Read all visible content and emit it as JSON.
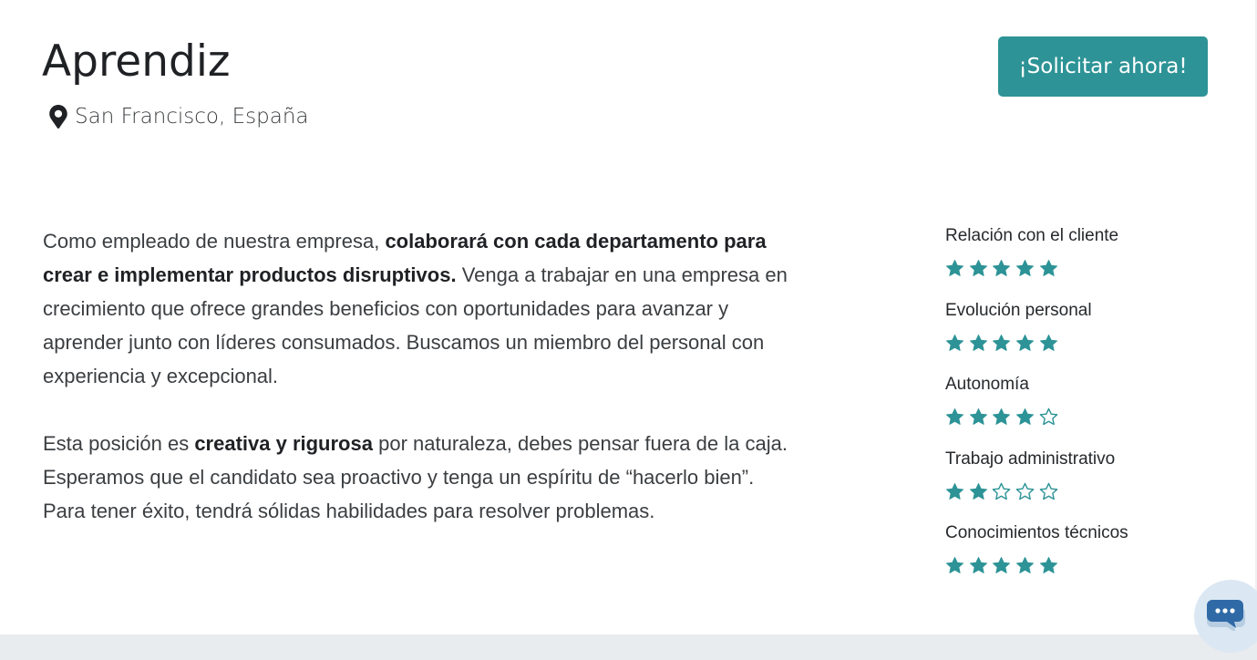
{
  "job": {
    "title": "Aprendiz",
    "location": "San Francisco, España",
    "apply_label": "¡Solicitar ahora!"
  },
  "description": {
    "p1_intro": "Como empleado de nuestra empresa, ",
    "p1_bold": "colaborará con cada departamento para crear e implementar productos disruptivos.",
    "p1_rest": " Venga a trabajar en una empresa en crecimiento que ofrece grandes beneficios con oportunidades para avanzar y aprender junto con líderes consumados. Buscamos un miembro del personal con experiencia y excepcional.",
    "p2_intro": "Esta posición es ",
    "p2_bold": "creativa y rigurosa",
    "p2_rest": " por naturaleza, debes pensar fuera de la caja. Esperamos que el candidato sea proactivo y tenga un espíritu de “hacerlo bien”. Para tener éxito, tendrá sólidas habilidades para resolver problemas."
  },
  "ratings": [
    {
      "label": "Relación con el cliente",
      "value": 5,
      "max": 5
    },
    {
      "label": "Evolución personal",
      "value": 5,
      "max": 5
    },
    {
      "label": "Autonomía",
      "value": 4,
      "max": 5
    },
    {
      "label": "Trabajo administrativo",
      "value": 2,
      "max": 5
    },
    {
      "label": "Conocimientos técnicos",
      "value": 5,
      "max": 5
    }
  ],
  "icons": {
    "location": "map-marker-icon",
    "star_filled": "star-filled-icon",
    "star_empty": "star-outline-icon",
    "chat": "chat-bubble-icon"
  },
  "colors": {
    "accent": "#2d9396",
    "chat": "#2f6aa6",
    "footer": "#e9ecef"
  }
}
